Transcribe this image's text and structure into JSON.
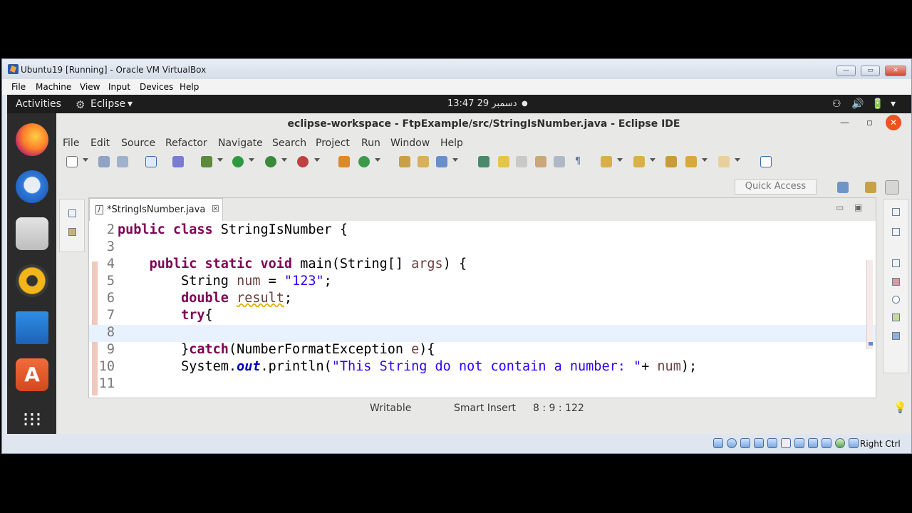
{
  "vbox": {
    "title": "Ubuntu19 [Running] - Oracle VM VirtualBox",
    "menu": [
      "File",
      "Machine",
      "View",
      "Input",
      "Devices",
      "Help"
    ],
    "min": "—",
    "restore": "▭",
    "close": "✕",
    "status_right": "Right Ctrl"
  },
  "gnome": {
    "activities": "Activities",
    "app": "Eclipse",
    "app_arrow": "▾",
    "clock": "13:47  29 دسمبر",
    "dot": "●",
    "tray": [
      "⚇",
      "🔊",
      "🔋",
      "▾"
    ]
  },
  "eclipse": {
    "title": "eclipse-workspace - FtpExample/src/StringIsNumber.java - Eclipse IDE",
    "min": "—",
    "max": "▫",
    "close": "✕",
    "menu": [
      "File",
      "Edit",
      "Source",
      "Refactor",
      "Navigate",
      "Search",
      "Project",
      "Run",
      "Window",
      "Help"
    ],
    "quick_access": "Quick Access",
    "tab": {
      "label": "*StringIsNumber.java",
      "close": "☒",
      "icon": "J"
    },
    "code": [
      {
        "n": "2",
        "t": "public class StringIsNumber {"
      },
      {
        "n": "3",
        "t": ""
      },
      {
        "n": "4",
        "t": "    public static void main(String[] args) {"
      },
      {
        "n": "5",
        "t": "        String num = \"123\";"
      },
      {
        "n": "6",
        "t": "        double result;"
      },
      {
        "n": "7",
        "t": "        try{"
      },
      {
        "n": "8",
        "t": ""
      },
      {
        "n": "9",
        "t": "        }catch(NumberFormatException e){"
      },
      {
        "n": "10",
        "t": "        System.out.println(\"This String do not contain a number: \"+ num);"
      },
      {
        "n": "11",
        "t": ""
      }
    ],
    "status": {
      "mode": "Writable",
      "insert": "Smart Insert",
      "position": "8 : 9 : 122"
    }
  }
}
